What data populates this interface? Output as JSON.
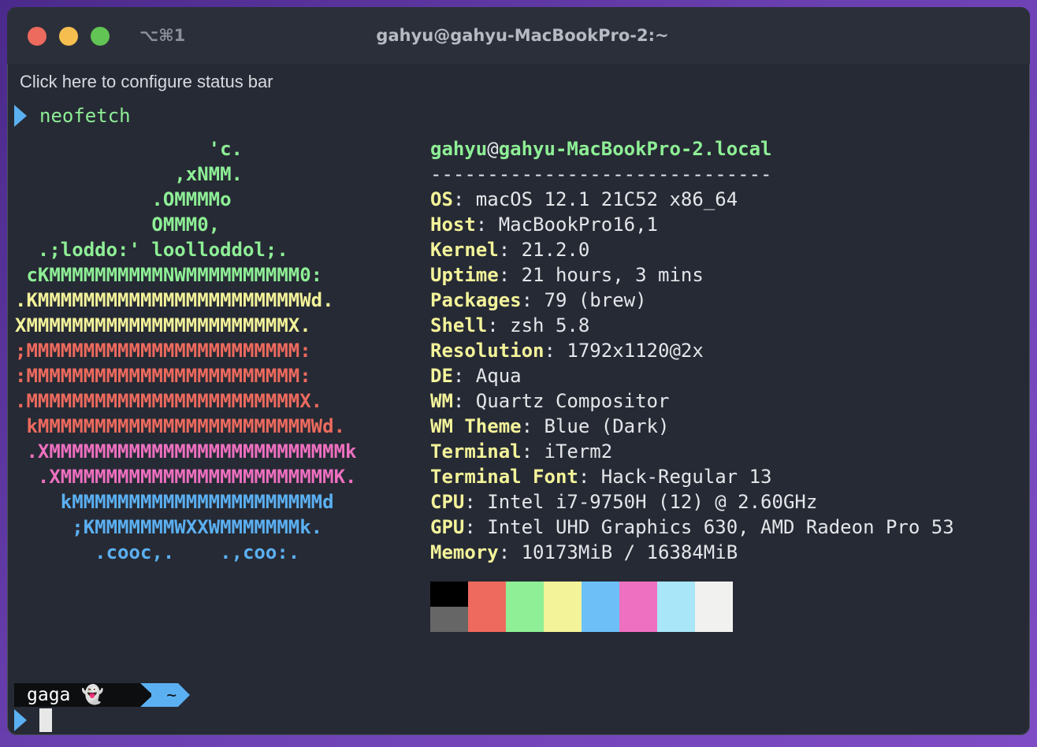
{
  "window": {
    "shortcut": "⌥⌘1",
    "title": "gahyu@gahyu-MacBookPro-2:~"
  },
  "status_bar_text": "Click here to configure status bar",
  "command": "neofetch",
  "ascii_lines": [
    {
      "text": "                 'c.",
      "color": "#8eef96"
    },
    {
      "text": "              ,xNMM.",
      "color": "#8eef96"
    },
    {
      "text": "            .OMMMMo",
      "color": "#8eef96"
    },
    {
      "text": "            OMMM0,",
      "color": "#8eef96"
    },
    {
      "text": "  .;loddo:' loolloddol;.",
      "color": "#8eef96"
    },
    {
      "text": " cKMMMMMMMMMMNWMMMMMMMMMM0:",
      "color": "#8eef96"
    },
    {
      "text": ".KMMMMMMMMMMMMMMMMMMMMMMMWd.",
      "color": "#f3f39a"
    },
    {
      "text": "XMMMMMMMMMMMMMMMMMMMMMMMX.",
      "color": "#f3f39a"
    },
    {
      "text": ";MMMMMMMMMMMMMMMMMMMMMMMM:",
      "color": "#ee6a5e"
    },
    {
      "text": ":MMMMMMMMMMMMMMMMMMMMMMMM:",
      "color": "#ee6a5e"
    },
    {
      "text": ".MMMMMMMMMMMMMMMMMMMMMMMMX.",
      "color": "#ee6a5e"
    },
    {
      "text": " kMMMMMMMMMMMMMMMMMMMMMMMMWd.",
      "color": "#ee6a5e"
    },
    {
      "text": " .XMMMMMMMMMMMMMMMMMMMMMMMMMMk",
      "color": "#ee70c0"
    },
    {
      "text": "  .XMMMMMMMMMMMMMMMMMMMMMMMMK.",
      "color": "#ee70c0"
    },
    {
      "text": "    kMMMMMMMMMMMMMMMMMMMMMMd",
      "color": "#5bb0f2"
    },
    {
      "text": "     ;KMMMMMMMWXXWMMMMMMMk.",
      "color": "#5bb0f2"
    },
    {
      "text": "       .cooc,.    .,coo:.",
      "color": "#5bb0f2"
    }
  ],
  "info": {
    "user": "gahyu",
    "at": "@",
    "host": "gahyu-MacBookPro-2.local",
    "separator": "------------------------------",
    "rows": [
      {
        "key": "OS",
        "value": ": macOS 12.1 21C52 x86_64"
      },
      {
        "key": "Host",
        "value": ": MacBookPro16,1"
      },
      {
        "key": "Kernel",
        "value": ": 21.2.0"
      },
      {
        "key": "Uptime",
        "value": ": 21 hours, 3 mins"
      },
      {
        "key": "Packages",
        "value": ": 79 (brew)"
      },
      {
        "key": "Shell",
        "value": ": zsh 5.8"
      },
      {
        "key": "Resolution",
        "value": ": 1792x1120@2x"
      },
      {
        "key": "DE",
        "value": ": Aqua"
      },
      {
        "key": "WM",
        "value": ": Quartz Compositor"
      },
      {
        "key": "WM Theme",
        "value": ": Blue (Dark)"
      },
      {
        "key": "Terminal",
        "value": ": iTerm2"
      },
      {
        "key": "Terminal Font",
        "value": ": Hack-Regular 13"
      },
      {
        "key": "CPU",
        "value": ": Intel i7-9750H (12) @ 2.60GHz"
      },
      {
        "key": "GPU",
        "value": ": Intel UHD Graphics 630, AMD Radeon Pro 53"
      },
      {
        "key": "Memory",
        "value": ": 10173MiB / 16384MiB"
      }
    ]
  },
  "palette": [
    {
      "top": "#000000",
      "bottom": "#666666"
    },
    {
      "top": "#ee6a5e",
      "bottom": "#ee6a5e"
    },
    {
      "top": "#8eef96",
      "bottom": "#8eef96"
    },
    {
      "top": "#f3f39a",
      "bottom": "#f3f39a"
    },
    {
      "top": "#6cc0f7",
      "bottom": "#6cc0f7"
    },
    {
      "top": "#ee70c0",
      "bottom": "#ee70c0"
    },
    {
      "top": "#a9e6f7",
      "bottom": "#a9e6f7"
    },
    {
      "top": "#f1f1f0",
      "bottom": "#f1f1f0"
    }
  ],
  "prompt_segment": {
    "name": "gaga 👻",
    "dir": "~"
  },
  "colors": {
    "accent_blue": "#5bb0f2",
    "green": "#8eef96",
    "yellow": "#f3f39a"
  }
}
